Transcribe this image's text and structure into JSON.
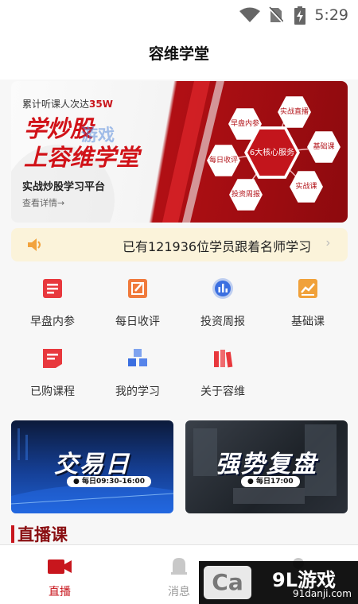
{
  "status_bar": {
    "time": "5:29"
  },
  "header": {
    "title": "容维学堂"
  },
  "banner": {
    "sub_prefix": "累计听课人次达",
    "sub_count": "35W",
    "title_line1": "学炒股",
    "title_line2": "上容维学堂",
    "tagline": "实战炒股学习平台",
    "more": "查看详情→",
    "watermark": "游戏",
    "center": "6大核心服务",
    "services": [
      "早盘内参",
      "实战直播",
      "每日收评",
      "基础课",
      "投资周报",
      "实战课"
    ]
  },
  "notice": {
    "text": "已有121936位学员跟着名师学习"
  },
  "menu": [
    {
      "label": "早盘内参",
      "icon": "news-icon",
      "color": "#e8383d"
    },
    {
      "label": "每日收评",
      "icon": "edit-icon",
      "color": "#f07a3c"
    },
    {
      "label": "投资周报",
      "icon": "chart-circle-icon",
      "color": "#3b6fe0"
    },
    {
      "label": "基础课",
      "icon": "trend-chart-icon",
      "color": "#f0a13a"
    },
    {
      "label": "已购课程",
      "icon": "purchased-icon",
      "color": "#e8383d"
    },
    {
      "label": "我的学习",
      "icon": "cubes-icon",
      "color": "#3b6fe0"
    },
    {
      "label": "关于容维",
      "icon": "books-icon",
      "color": "#e8383d"
    }
  ],
  "cards": [
    {
      "title": "交易日",
      "schedule": "每日09:30-16:00"
    },
    {
      "title": "强势复盘",
      "schedule": "每日17:00"
    }
  ],
  "section": {
    "title": "直播课"
  },
  "tabs": [
    {
      "label": "直播",
      "icon": "live-camera-icon"
    },
    {
      "label": "消息",
      "icon": "bell-icon"
    },
    {
      "label": "",
      "icon": "profile-icon"
    }
  ],
  "watermark_logo": {
    "brand": "9L游戏",
    "url": "91danji.com",
    "letter": "Ca"
  },
  "colors": {
    "accent": "#c8161d",
    "notice_bg": "#fbf3da",
    "page_bg": "#f7f7f7"
  }
}
